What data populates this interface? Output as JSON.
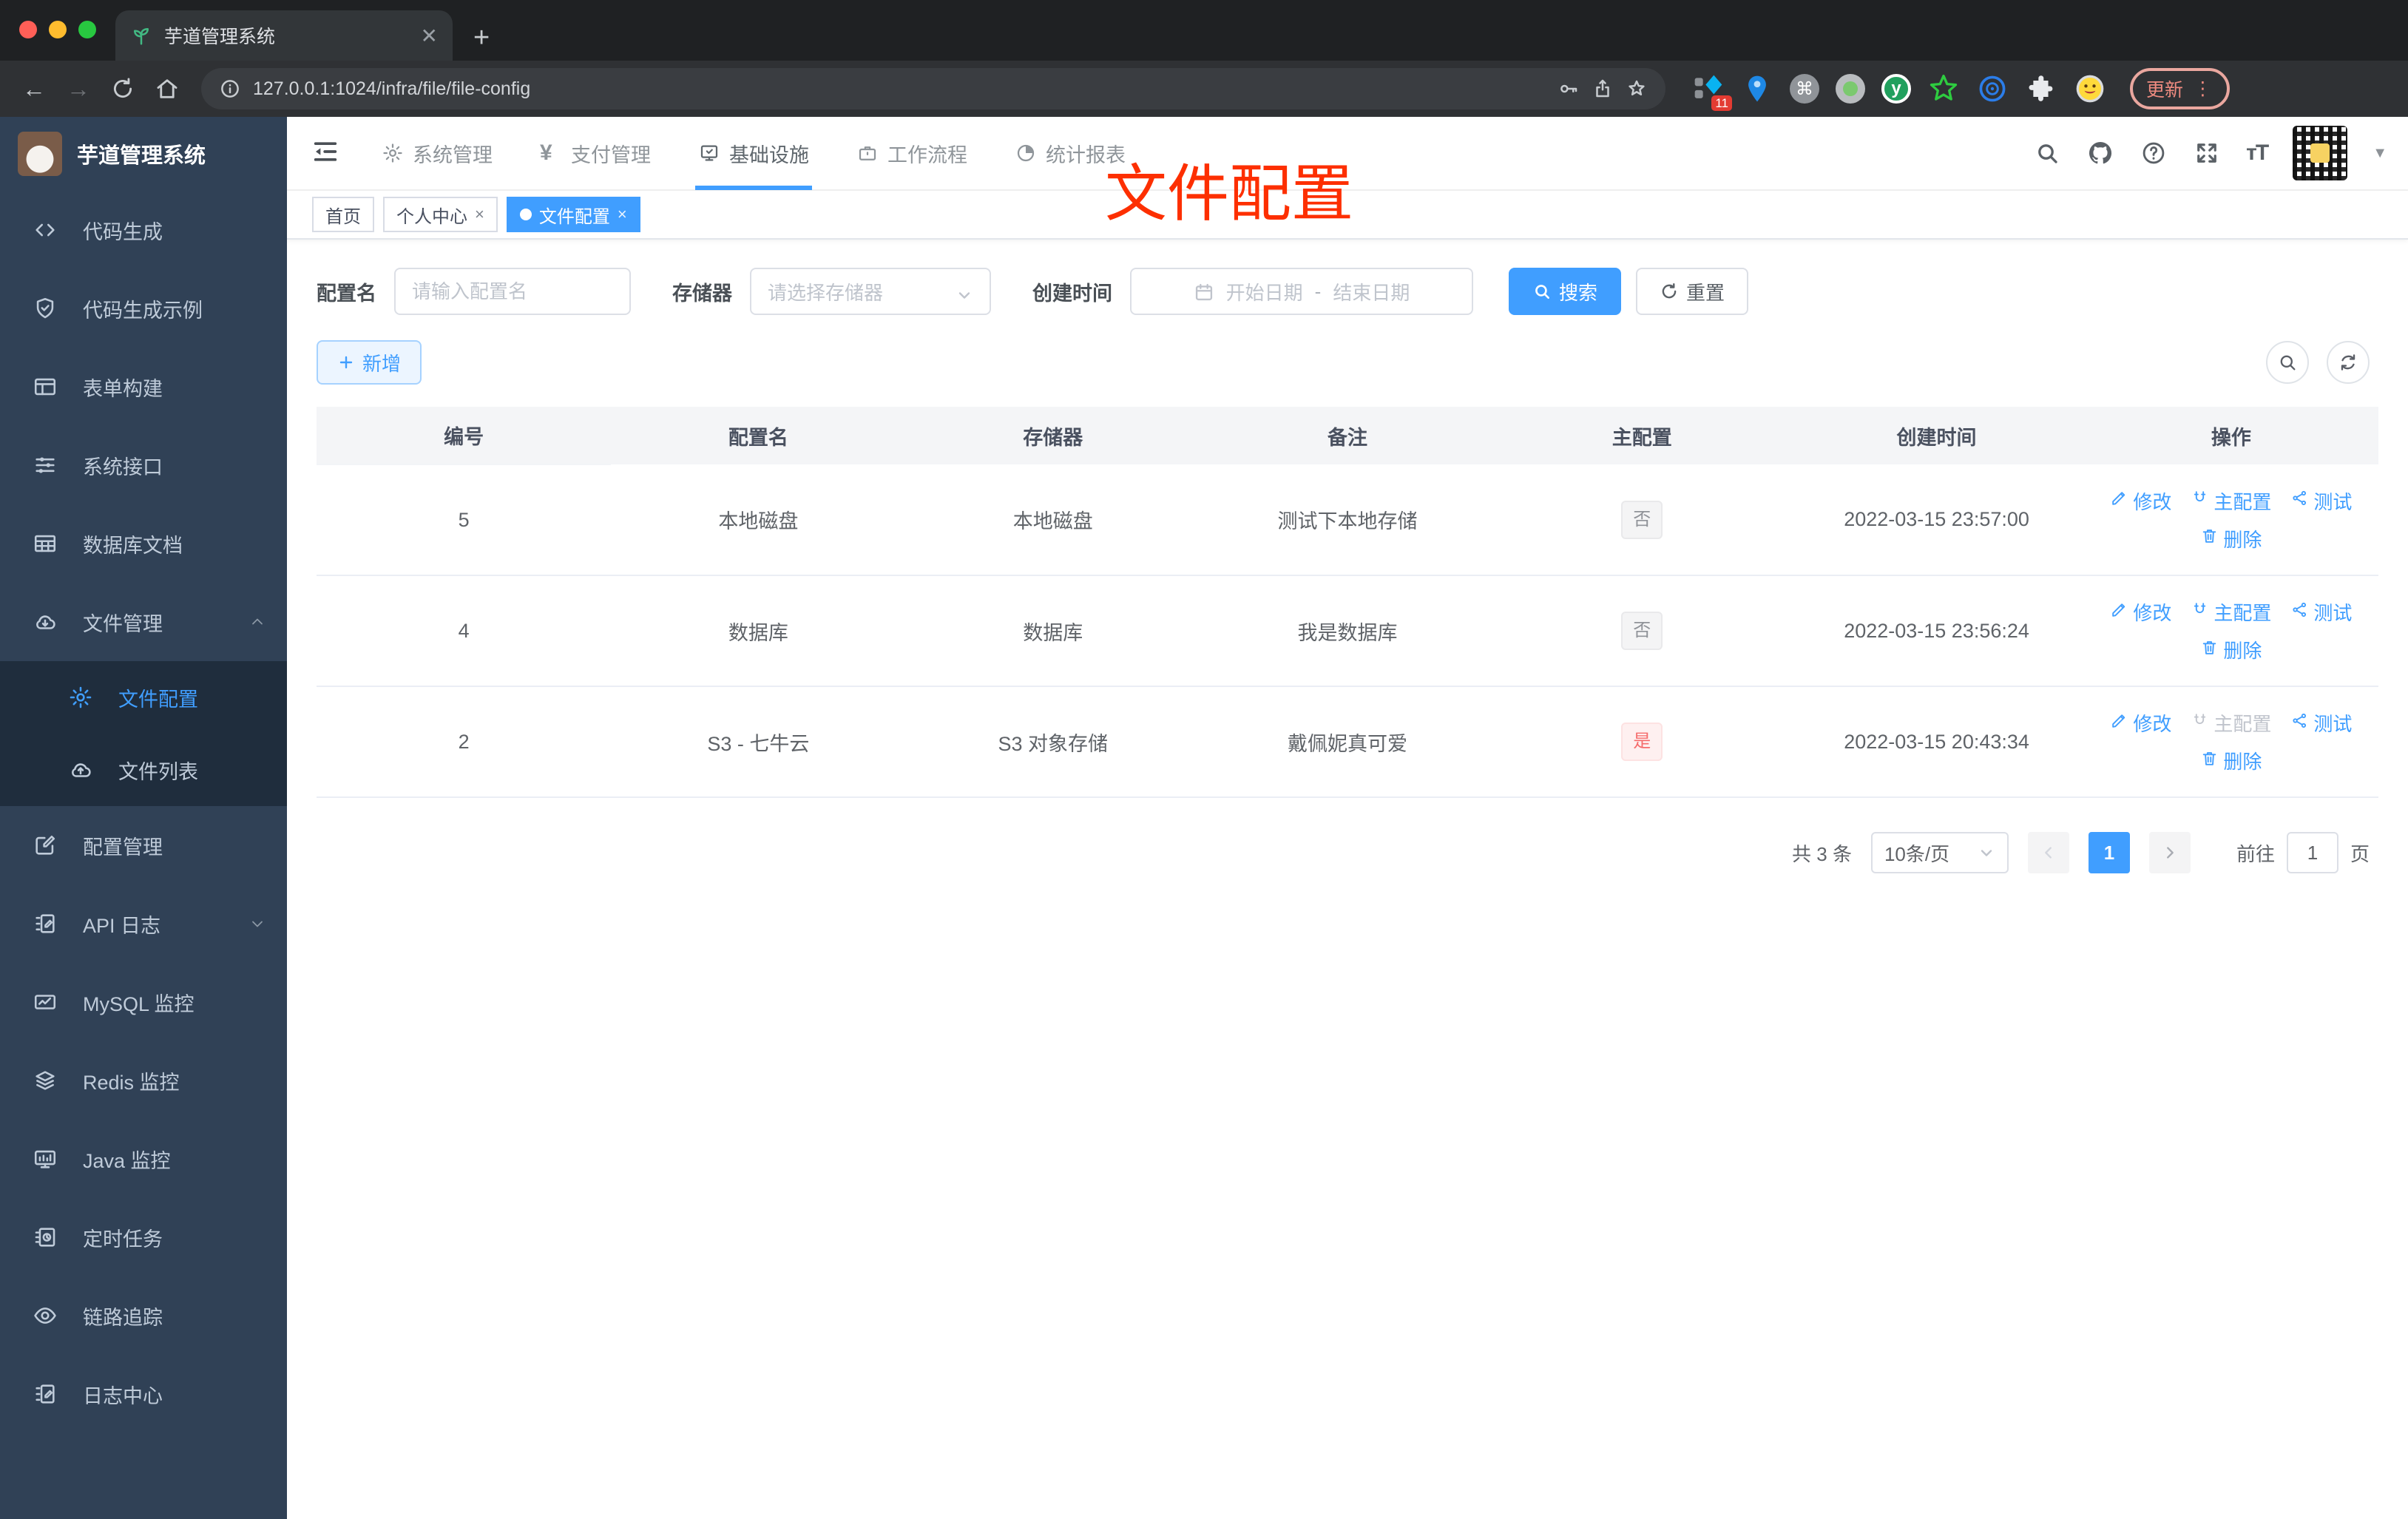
{
  "browser": {
    "tab_title": "芋道管理系统",
    "url": "127.0.0.1:1024/infra/file/file-config",
    "extension_badge": "11",
    "update_label": "更新"
  },
  "sidebar": {
    "logo_title": "芋道管理系统",
    "items": [
      {
        "label": "代码生成",
        "icon": "code-icon"
      },
      {
        "label": "代码生成示例",
        "icon": "shield-check-icon"
      },
      {
        "label": "表单构建",
        "icon": "form-build-icon"
      },
      {
        "label": "系统接口",
        "icon": "sliders-icon"
      },
      {
        "label": "数据库文档",
        "icon": "db-doc-icon"
      },
      {
        "label": "文件管理",
        "icon": "cloud-download-icon",
        "expand": "up"
      },
      {
        "label": "文件配置",
        "icon": "gear-icon",
        "sub": true,
        "active": true
      },
      {
        "label": "文件列表",
        "icon": "cloud-upload-icon",
        "sub": true
      },
      {
        "label": "配置管理",
        "icon": "edit-square-icon"
      },
      {
        "label": "API 日志",
        "icon": "doc-edit-icon",
        "expand": "down"
      },
      {
        "label": "MySQL 监控",
        "icon": "chart-icon"
      },
      {
        "label": "Redis 监控",
        "icon": "layers-icon"
      },
      {
        "label": "Java 监控",
        "icon": "monitor-icon"
      },
      {
        "label": "定时任务",
        "icon": "timer-icon"
      },
      {
        "label": "链路追踪",
        "icon": "eye-icon"
      },
      {
        "label": "日志中心",
        "icon": "log-edit-icon"
      }
    ]
  },
  "topnav": {
    "items": [
      {
        "label": "系统管理",
        "icon": "gear-icon"
      },
      {
        "label": "支付管理",
        "icon": "yen-icon"
      },
      {
        "label": "基础设施",
        "icon": "monitor-check-icon",
        "active": true
      },
      {
        "label": "工作流程",
        "icon": "briefcase-icon"
      },
      {
        "label": "统计报表",
        "icon": "gauge-icon"
      }
    ]
  },
  "tags": [
    {
      "label": "首页"
    },
    {
      "label": "个人中心",
      "closable": true
    },
    {
      "label": "文件配置",
      "closable": true,
      "active": true
    }
  ],
  "annotation": "文件配置",
  "filters": {
    "name_label": "配置名",
    "name_placeholder": "请输入配置名",
    "storage_label": "存储器",
    "storage_placeholder": "请选择存储器",
    "time_label": "创建时间",
    "start_placeholder": "开始日期",
    "separator": "-",
    "end_placeholder": "结束日期",
    "search_label": "搜索",
    "reset_label": "重置"
  },
  "toolbar": {
    "add_label": "新增"
  },
  "table": {
    "headers": [
      "编号",
      "配置名",
      "存储器",
      "备注",
      "主配置",
      "创建时间",
      "操作"
    ],
    "action_labels": {
      "edit": "修改",
      "master": "主配置",
      "test": "测试",
      "delete": "删除"
    },
    "rows": [
      {
        "id": "5",
        "name": "本地磁盘",
        "storage": "本地磁盘",
        "remark": "测试下本地存储",
        "master": "否",
        "master_type": "info",
        "time": "2022-03-15 23:57:00",
        "master_action_disabled": false
      },
      {
        "id": "4",
        "name": "数据库",
        "storage": "数据库",
        "remark": "我是数据库",
        "master": "否",
        "master_type": "info",
        "time": "2022-03-15 23:56:24",
        "master_action_disabled": false
      },
      {
        "id": "2",
        "name": "S3 - 七牛云",
        "storage": "S3 对象存储",
        "remark": "戴佩妮真可爱",
        "master": "是",
        "master_type": "danger",
        "time": "2022-03-15 20:43:34",
        "master_action_disabled": true
      }
    ]
  },
  "pagination": {
    "total": "共 3 条",
    "page_size": "10条/页",
    "current_page": "1",
    "goto_label": "前往",
    "goto_value": "1",
    "unit_label": "页"
  },
  "colors": {
    "primary": "#409eff",
    "danger": "#f56c6c",
    "annotation_red": "#fd2f00",
    "sidebar_bg": "#304156",
    "submenu_bg": "#1f2d3d"
  }
}
